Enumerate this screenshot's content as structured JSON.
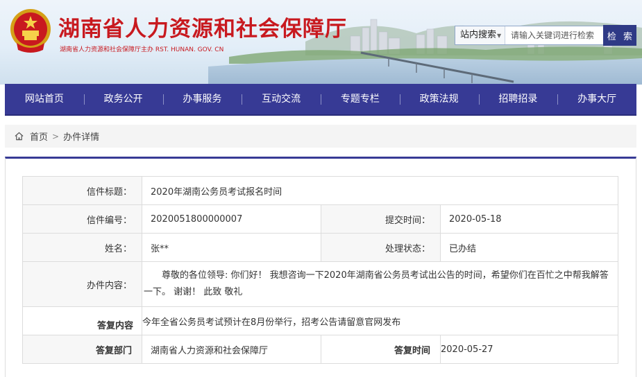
{
  "header": {
    "site_title": "湖南省人力资源和社会保障厅",
    "site_subtitle": "湖南省人力资源和社会保障厅主办  RST. HUNAN. GOV. CN",
    "emblem_icon": "national-emblem-icon",
    "search": {
      "scope_label": "站内搜索",
      "placeholder": "请输入关键词进行检索",
      "button_label": "检 索"
    }
  },
  "nav": {
    "items": [
      "网站首页",
      "政务公开",
      "办事服务",
      "互动交流",
      "专题专栏",
      "政策法规",
      "招聘招录",
      "办事大厅"
    ]
  },
  "breadcrumb": {
    "home": "首页",
    "separator": ">",
    "current": "办件详情"
  },
  "detail": {
    "title_label": "信件标题：",
    "title_value": "2020年湖南公务员考试报名时间",
    "number_label": "信件编号：",
    "number_value": "2020051800000007",
    "submit_time_label": "提交时间：",
    "submit_time_value": "2020-05-18",
    "name_label": "姓名：",
    "name_value": "张**",
    "status_label": "处理状态：",
    "status_value": "已办结",
    "content_label": "办件内容：",
    "content_value": "尊敬的各位领导: 你们好！ 我想咨询一下2020年湖南省公务员考试出公告的时间，希望你们在百忙之中帮我解答一下。 谢谢！ 此致 敬礼",
    "reply_label": "答复内容",
    "reply_value": "今年全省公务员考试预计在8月份举行，招考公告请留意官网发布",
    "reply_dept_label": "答复部门",
    "reply_dept_value": "湖南省人力资源和社会保障厅",
    "reply_time_label": "答复时间",
    "reply_time_value": "2020-05-27"
  },
  "colors": {
    "brand_red": "#c8191f",
    "nav_blue": "#373a95",
    "search_button": "#2f3a86"
  }
}
